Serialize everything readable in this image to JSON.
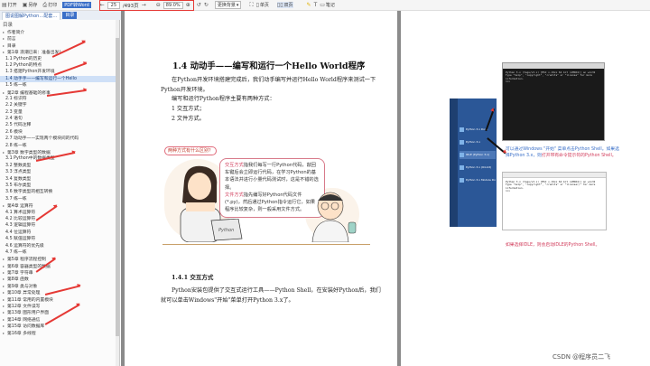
{
  "toolbar": {
    "open_label": "打开",
    "saveas_label": "另存",
    "print_label": "打印",
    "toword_label": "PDF转Word",
    "page_value": "25",
    "page_total": "/493页",
    "zoom_value": "89.0%",
    "bg_label": "更换背景",
    "single_label": "单页",
    "double_label": "双页",
    "note_label": "笔记"
  },
  "tabs": {
    "tab1": "图说图解Python…配套…",
    "tab2": "目录"
  },
  "sidebar": {
    "header": "目录",
    "items": [
      {
        "text": "作者简介",
        "level": 0
      },
      {
        "text": "前言",
        "level": 0
      },
      {
        "text": "目录",
        "level": 0
      },
      {
        "text": "第1章 浪潮已来：准备出发！",
        "level": 0
      },
      {
        "text": "1.1 Python的历史",
        "level": 1
      },
      {
        "text": "1.2 Python的特点",
        "level": 1
      },
      {
        "text": "1.3 搭建Python开发环境",
        "level": 1
      },
      {
        "text": "1.4 动手手——编写和运行一个Hello",
        "level": 1,
        "selected": true
      },
      {
        "text": "1.5 练一练",
        "level": 1
      },
      {
        "text": "第2章 编程基础的修事",
        "level": 0
      },
      {
        "text": "2.1 标识符",
        "level": 1
      },
      {
        "text": "2.2 关键字",
        "level": 1
      },
      {
        "text": "2.3 变量",
        "level": 1
      },
      {
        "text": "2.4 语句",
        "level": 1
      },
      {
        "text": "2.5 代码注释",
        "level": 1
      },
      {
        "text": "2.6 模块",
        "level": 1
      },
      {
        "text": "2.7 动动手——实现两个模块间的代码",
        "level": 1
      },
      {
        "text": "2.8 练一练",
        "level": 1
      },
      {
        "text": "第3章 数字类型的数据",
        "level": 0
      },
      {
        "text": "3.1 Python中的数据类型",
        "level": 1
      },
      {
        "text": "3.2 整数类型",
        "level": 1
      },
      {
        "text": "3.3 浮点类型",
        "level": 1
      },
      {
        "text": "3.4 复数类型",
        "level": 1
      },
      {
        "text": "3.5 布尔类型",
        "level": 1
      },
      {
        "text": "3.6 数字类型的相互转换",
        "level": 1
      },
      {
        "text": "3.7 练一练",
        "level": 1
      },
      {
        "text": "第4章 运算符",
        "level": 0
      },
      {
        "text": "4.1 算术运算符",
        "level": 1
      },
      {
        "text": "4.2 比较运算符",
        "level": 1
      },
      {
        "text": "4.3 逻辑运算符",
        "level": 1
      },
      {
        "text": "4.4 位运算符",
        "level": 1
      },
      {
        "text": "4.5 赋值运算符",
        "level": 1
      },
      {
        "text": "4.6 运算符的优先级",
        "level": 1
      },
      {
        "text": "4.7 练一练",
        "level": 1
      },
      {
        "text": "第5章 程序流程控制",
        "level": 0
      },
      {
        "text": "第6章 容器类型的数据",
        "level": 0
      },
      {
        "text": "第7章 字符串",
        "level": 0
      },
      {
        "text": "第8章 函数",
        "level": 0
      },
      {
        "text": "第9章 类与对象",
        "level": 0
      },
      {
        "text": "第10章 异常处理",
        "level": 0
      },
      {
        "text": "第11章 常用的内置模块",
        "level": 0
      },
      {
        "text": "第12章 文件读写",
        "level": 0
      },
      {
        "text": "第13章 图形用户界面",
        "level": 0
      },
      {
        "text": "第14章 网络通信",
        "level": 0
      },
      {
        "text": "第15章 访问数据库",
        "level": 0
      },
      {
        "text": "第16章 多线程",
        "level": 0
      }
    ]
  },
  "doc_left": {
    "heading": "1.4 动动手——编写和运行一个Hello World程序",
    "para1": "在Python开发环境搭建完成后，我们动手编写并运行Hello World程序来测试一下Python开发环境。",
    "para2": "编写和运行Python程序主要有两种方式：",
    "item1": "1 交互方式；",
    "item2": "2 文件方式。",
    "bubble_left": "两种方式有什么区别？",
    "bubble_right_a": "交互方式",
    "bubble_right_b": "指我们每写一行Python代码，敲回车键后会立即运行代码，在学习Python的基本语法并进行小量代码测试时，这是不错的选择。",
    "bubble_right_c": "文件方式",
    "bubble_right_d": "指先编写好Python代码文件(*.py)，然后通过Python指令运行它，如果程序比较复杂，则一般采用文件方式。",
    "laptop_label": "Python",
    "sub_heading": "1.4.1 交互方式",
    "para3": "Python安装包提供了交互式运行工具——Python Shell，在安装好Python后，我们就可以单击Windows\"开始\"菜单打开Python 3.x了。"
  },
  "doc_right": {
    "console_lines": "Python 3.x (tags/v3.x) [MSC v.19xx 64 bit (AMD64)] on win32\nType \"help\", \"copyright\", \"credits\" or \"license\" for more information.\n>>>",
    "start_items": [
      "Python 3.x Docs",
      "Python 3.x",
      "IDLE (Python 3.x)",
      "Python 3.x (64-bit)",
      "Python 3.x Module Docs"
    ],
    "note1_a": "可以通过Windows \"开始\" 菜单点击Python Shell。如果选择Python 3.x，则",
    "note1_b": "打开带有命令提示符的Python Shell。",
    "shell_lines": "Python 3.x (tags/v3.x) [MSC v.19xx 64 bit (AMD64)] on win32\nType \"help\", \"copyright\", \"credits\" or \"license()\" for more information.\n>>>",
    "note2": "如果选择IDLE，则会启动IDLE的Python Shell。"
  },
  "watermark": "CSDN @程序员二飞",
  "colors": {
    "accent": "#3a6fc8",
    "annotation": "#e53935",
    "highlight": "#d13c5b"
  }
}
